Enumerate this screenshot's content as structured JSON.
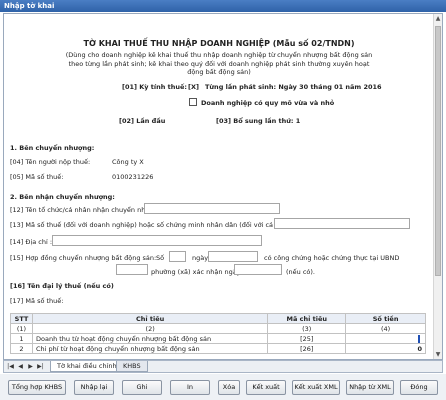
{
  "window": {
    "title": "Nhập tờ khai"
  },
  "form": {
    "title": "TỜ KHAI THUẾ THU NHẬP DOANH NGHIỆP (Mẫu số 02/TNDN)",
    "note": "(Dùng cho doanh nghiệp kê khai thuế  thu nhập doanh nghiệp từ chuyển nhượng bất động sản theo từng lần phát sinh; kê khai theo quý đối với doanh nghiệp phát sinh thường xuyên hoạt động bất động sản)",
    "ky_tinh_thue_label": "[01] Kỳ tính thuế:",
    "ky_tinh_thue_mark": "[X]",
    "ky_tinh_thue_value": "Từng lần phát sinh:  Ngày 30 tháng 01 năm 2016",
    "dn_vua_nho_label": "Doanh nghiệp có quy mô vừa và nhỏ",
    "lan_dau": "[02] Lần đầu",
    "bo_sung": "[03] Bổ sung  lần thứ:  1"
  },
  "section1": {
    "heading": "1. Bên chuyển nhượng:",
    "ten_nnt_label": "[04] Tên người nộp thuế:",
    "ten_nnt_value": "Công ty X",
    "mst_label": "[05] Mã số thuế:",
    "mst_value": "0100231226"
  },
  "section2": {
    "heading": "2. Bên nhận chuyển nhượng:",
    "f12_label": "[12] Tên tổ chức/cá nhân nhận chuyển nhượng:",
    "f13_label": "[13] Mã số thuế (đối với doanh nghiệp) hoặc số chứng minh nhân dân (đối với cá nhân):",
    "f14_label": "[14] Địa chỉ :",
    "f15_label": "[15] Hợp đồng chuyển nhượng bất động sản:",
    "so_label": "Số",
    "ngay_label": "ngày",
    "cong_chung_label": "có công chứng hoặc chứng thực tại UBND",
    "phuong_label": "phường (xã)  xác nhận ngày",
    "neu_co_label": "(nếu có)."
  },
  "section3": {
    "heading": "[16] Tên đại lý thuế (nếu có)",
    "mst_label": "[17] Mã số thuế:"
  },
  "table": {
    "headers": [
      "STT",
      "Chỉ tiêu",
      "Mã chỉ tiêu",
      "Số tiền"
    ],
    "subheaders": [
      "(1)",
      "(2)",
      "(3)",
      "(4)"
    ],
    "rows": [
      {
        "stt": "1",
        "chi_tieu": "Doanh thu từ hoạt động chuyển nhượng bất động sản",
        "ma": "[25]",
        "so_tien": ""
      },
      {
        "stt": "2",
        "chi_tieu": "Chi phí từ hoạt động chuyển nhượng bất động sản",
        "ma": "[26]",
        "so_tien": "0"
      }
    ]
  },
  "sheets": {
    "tab1": "Tờ khai điều chỉnh",
    "tab2": "KHBS"
  },
  "buttons": {
    "tong_hop": "Tổng hợp KHBS",
    "nhap_lai": "Nhập lại",
    "ghi": "Ghi",
    "in": "In",
    "xoa": "Xóa",
    "ket_xuat": "Kết xuất",
    "ket_xuat_xml": "Kết xuất XML",
    "nhap_tu_xml": "Nhập từ XML",
    "dong": "Đóng"
  }
}
